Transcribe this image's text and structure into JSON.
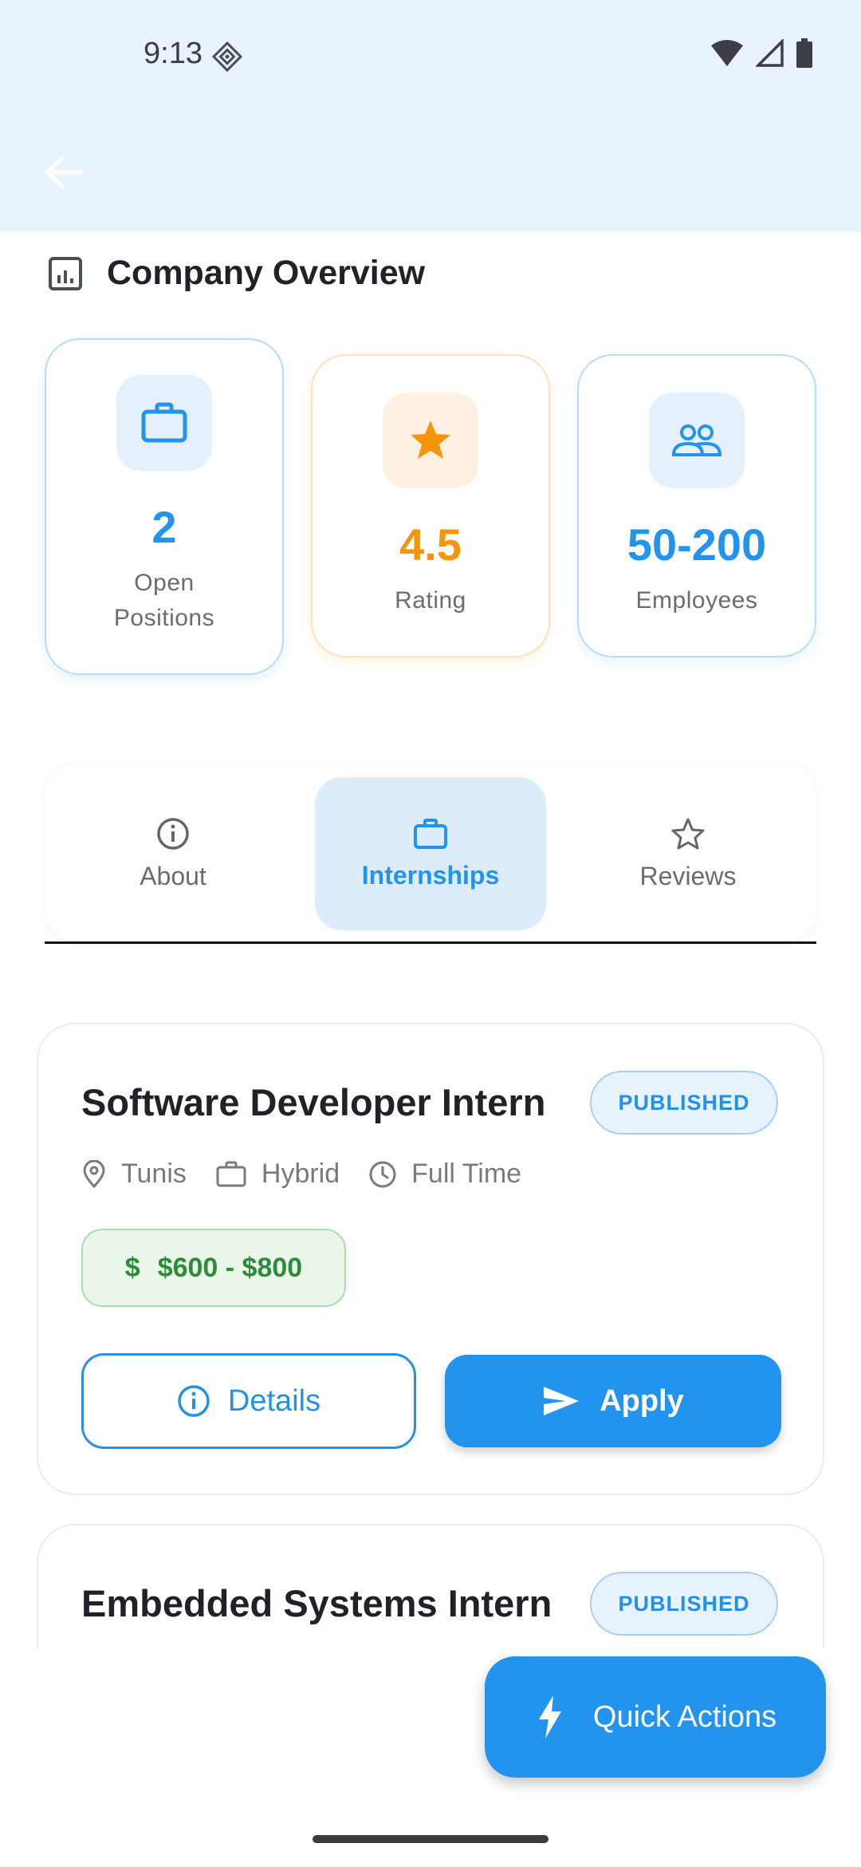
{
  "status_bar": {
    "time": "9:13"
  },
  "colors": {
    "primary": "#2394ee",
    "orange": "#f5950c",
    "green": "#2e8b3a",
    "header_bg": "#e9f3fd"
  },
  "overview": {
    "title": "Company Overview",
    "stats": [
      {
        "value": "2",
        "label_line1": "Open",
        "label_line2": "Positions",
        "icon": "briefcase-icon"
      },
      {
        "value": "4.5",
        "label": "Rating",
        "icon": "star-icon"
      },
      {
        "value": "50-200",
        "label": "Employees",
        "icon": "people-icon"
      }
    ]
  },
  "tabs": [
    {
      "label": "About",
      "icon": "info-icon",
      "selected": false
    },
    {
      "label": "Internships",
      "icon": "briefcase-icon",
      "selected": true
    },
    {
      "label": "Reviews",
      "icon": "star-outline-icon",
      "selected": false
    }
  ],
  "jobs": [
    {
      "title": "Software Developer Intern",
      "status": "PUBLISHED",
      "location": "Tunis",
      "mode": "Hybrid",
      "type": "Full Time",
      "salary": "$600 - $800",
      "salary_symbol": "$",
      "details_label": "Details",
      "apply_label": "Apply"
    },
    {
      "title": "Embedded Systems Intern",
      "status": "PUBLISHED"
    }
  ],
  "fab": {
    "label": "Quick Actions",
    "icon": "bolt-icon"
  }
}
